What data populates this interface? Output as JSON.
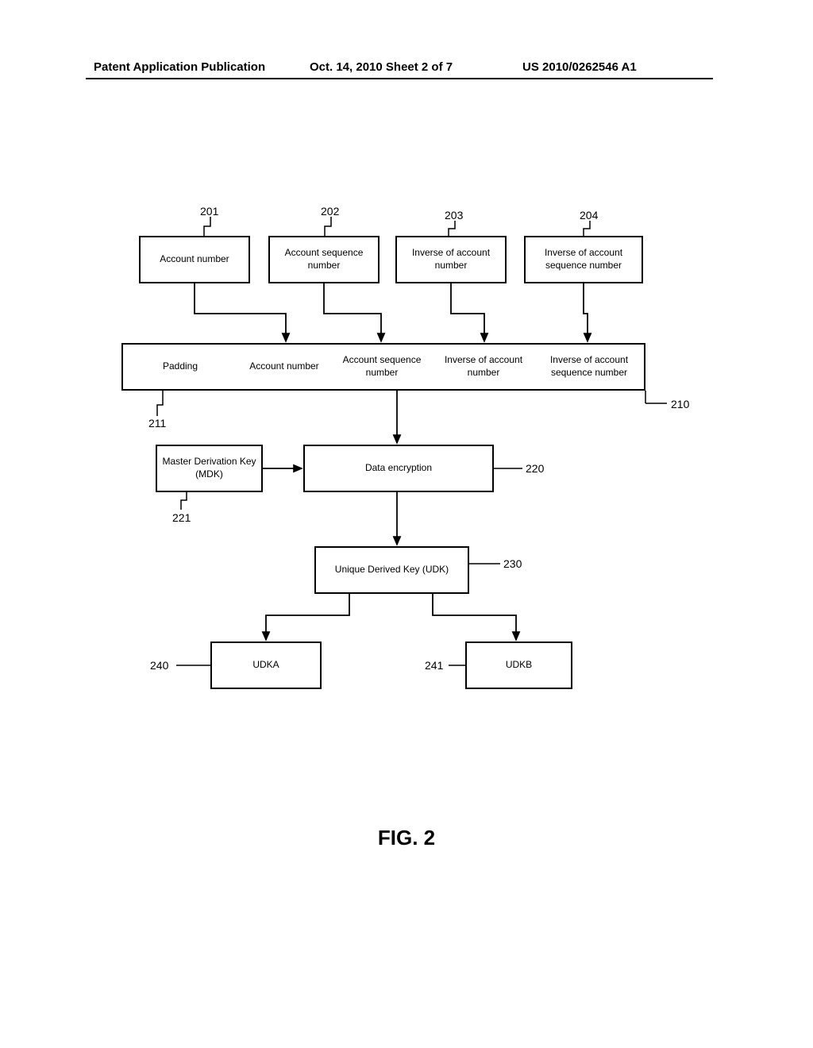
{
  "header": {
    "left": "Patent Application Publication",
    "mid": "Oct. 14, 2010   Sheet 2 of 7",
    "right": "US 2010/0262546 A1"
  },
  "refs": {
    "r201": "201",
    "r202": "202",
    "r203": "203",
    "r204": "204",
    "r210": "210",
    "r211": "211",
    "r220": "220",
    "r221": "221",
    "r230": "230",
    "r240": "240",
    "r241": "241"
  },
  "boxes": {
    "input1": "Account number",
    "input2": "Account sequence number",
    "input3": "Inverse of account number",
    "input4": "Inverse of account sequence number",
    "row_padding": "Padding",
    "row_acct": "Account number",
    "row_seq": "Account sequence number",
    "row_inv_acct": "Inverse of account number",
    "row_inv_seq": "Inverse of account sequence number",
    "mdk": "Master Derivation Key (MDK)",
    "enc": "Data encryption",
    "udk": "Unique Derived Key (UDK)",
    "udka": "UDKA",
    "udkb": "UDKB"
  },
  "figure_caption": "FIG. 2"
}
